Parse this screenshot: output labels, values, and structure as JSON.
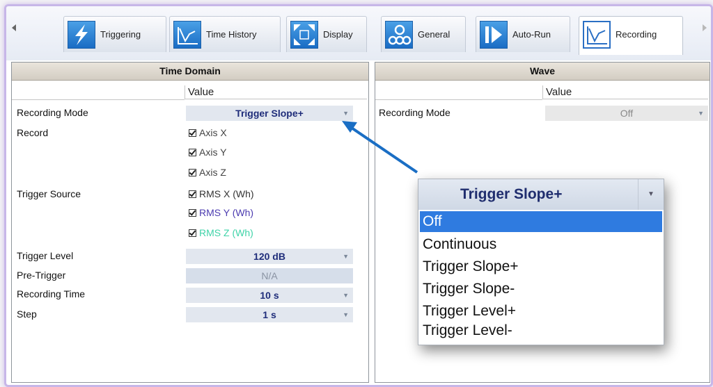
{
  "tabs": [
    {
      "label": "Triggering",
      "icon": "lightning-icon"
    },
    {
      "label": "Time History",
      "icon": "chart-line-icon"
    },
    {
      "label": "Display",
      "icon": "expand-arrows-icon"
    },
    {
      "label": "General",
      "icon": "gears-icon"
    },
    {
      "label": "Auto-Run",
      "icon": "play-icon"
    },
    {
      "label": "Recording",
      "icon": "chart-line-icon"
    }
  ],
  "left_panel": {
    "title": "Time Domain",
    "value_header": "Value",
    "recording_mode": {
      "label": "Recording Mode",
      "value": "Trigger Slope+"
    },
    "record_label": "Record",
    "checkboxes": [
      {
        "label": "Axis X",
        "color": "#444444"
      },
      {
        "label": "Axis Y",
        "color": "#444444"
      },
      {
        "label": "Axis Z",
        "color": "#444444"
      },
      {
        "label": "RMS X (Wh)",
        "color": "#333333"
      },
      {
        "label": "RMS Y (Wh)",
        "color": "#4b3bb0"
      },
      {
        "label": "RMS Z (Wh)",
        "color": "#3fd3a8"
      }
    ],
    "trigger_source_label": "Trigger Source",
    "trigger_level": {
      "label": "Trigger Level",
      "value": "120 dB"
    },
    "pre_trigger": {
      "label": "Pre-Trigger",
      "value": "N/A"
    },
    "recording_time": {
      "label": "Recording Time",
      "value": "10 s"
    },
    "step": {
      "label": "Step",
      "value": "1 s"
    }
  },
  "right_panel": {
    "title": "Wave",
    "value_header": "Value",
    "recording_mode": {
      "label": "Recording Mode",
      "value": "Off"
    }
  },
  "dropdown": {
    "selected_value": "Trigger Slope+",
    "options": [
      "Off",
      "Continuous",
      "Trigger Slope+",
      "Trigger Slope-",
      "Trigger Level+",
      "Trigger Level-"
    ],
    "highlighted_index": 0
  },
  "colors": {
    "arrow": "#1a6ec4",
    "highlight": "#2f7be0",
    "value_text": "#1f2d7a"
  }
}
